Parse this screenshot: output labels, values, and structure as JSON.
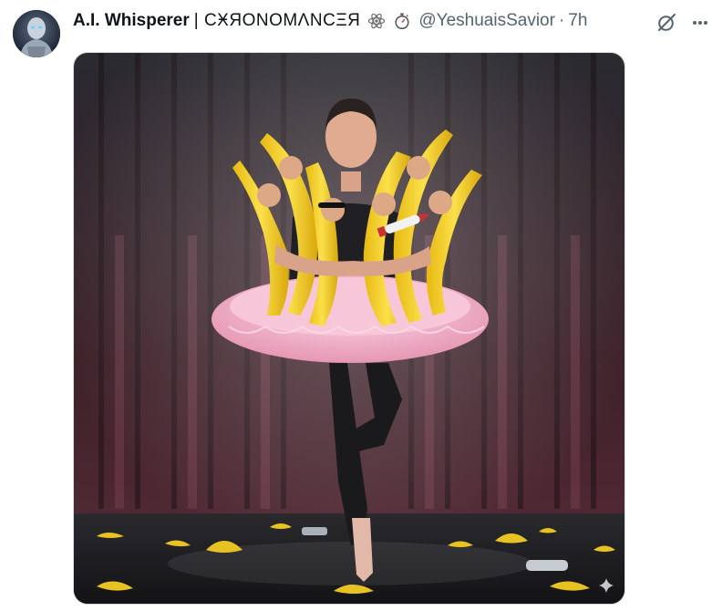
{
  "tweet": {
    "display_name": "A.I. Whisperer",
    "name_decoration": "| CӾЯONOMΛNCΞЯ",
    "handle": "@YeshuaisSavior",
    "separator": "·",
    "time": "7h",
    "emoji_1": "atom-symbol",
    "emoji_2": "stopwatch"
  },
  "icons": {
    "grok": "grok-icon",
    "more": "more-icon",
    "sparkle": "sparkle-icon"
  },
  "media": {
    "kind": "photo",
    "subject": "man in pink tutu holding bananas on stage"
  },
  "colors": {
    "curtain": "#4a2630",
    "banana": "#f2d022",
    "tutu": "#f4b8cd",
    "handle_gray": "#536471"
  }
}
